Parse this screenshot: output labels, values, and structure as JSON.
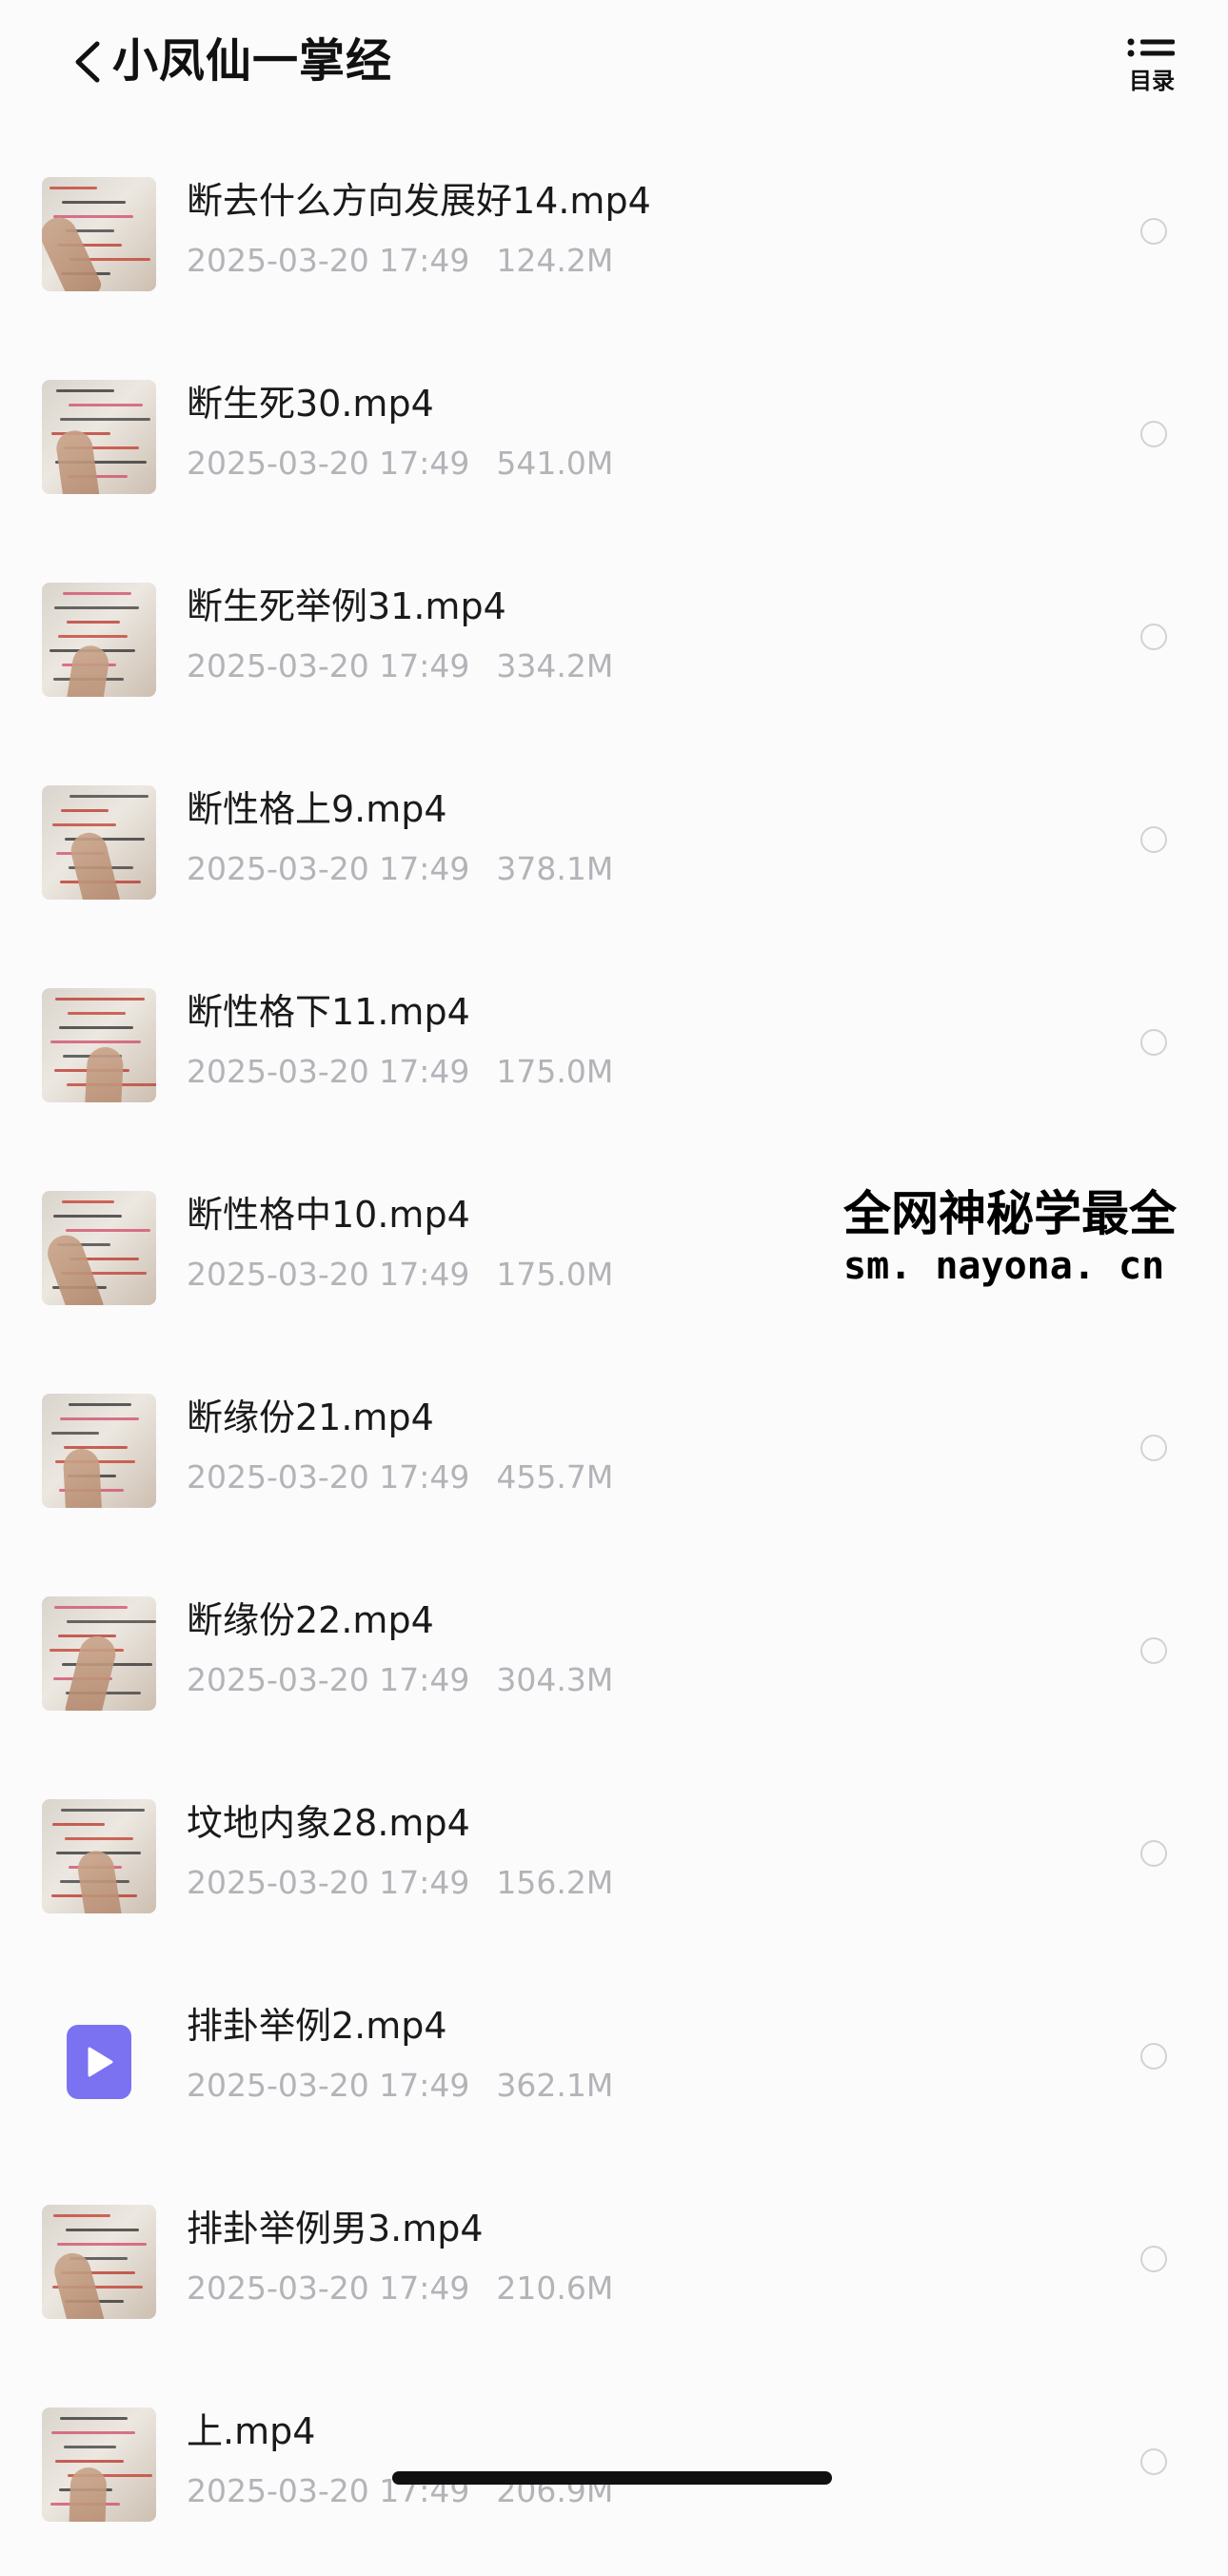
{
  "header": {
    "back_icon": "chevron-left-icon",
    "title": "小凤仙一掌经",
    "toc_icon": "list-icon",
    "toc_label": "目录"
  },
  "files": [
    {
      "name": "断去什么方向发展好14.mp4",
      "date": "2025-03-20 17:49",
      "size": "124.2M",
      "thumb": "photo"
    },
    {
      "name": "断生死30.mp4",
      "date": "2025-03-20 17:49",
      "size": "541.0M",
      "thumb": "photo"
    },
    {
      "name": "断生死举例31.mp4",
      "date": "2025-03-20 17:49",
      "size": "334.2M",
      "thumb": "photo"
    },
    {
      "name": "断性格上9.mp4",
      "date": "2025-03-20 17:49",
      "size": "378.1M",
      "thumb": "photo"
    },
    {
      "name": "断性格下11.mp4",
      "date": "2025-03-20 17:49",
      "size": "175.0M",
      "thumb": "photo"
    },
    {
      "name": "断性格中10.mp4",
      "date": "2025-03-20 17:49",
      "size": "175.0M",
      "thumb": "photo"
    },
    {
      "name": "断缘份21.mp4",
      "date": "2025-03-20 17:49",
      "size": "455.7M",
      "thumb": "photo"
    },
    {
      "name": "断缘份22.mp4",
      "date": "2025-03-20 17:49",
      "size": "304.3M",
      "thumb": "photo"
    },
    {
      "name": "坟地内象28.mp4",
      "date": "2025-03-20 17:49",
      "size": "156.2M",
      "thumb": "photo"
    },
    {
      "name": "排卦举例2.mp4",
      "date": "2025-03-20 17:49",
      "size": "362.1M",
      "thumb": "video-icon"
    },
    {
      "name": "排卦举例男3.mp4",
      "date": "2025-03-20 17:49",
      "size": "210.6M",
      "thumb": "photo"
    },
    {
      "name": "上.mp4",
      "date": "2025-03-20 17:49",
      "size": "206.9M",
      "thumb": "photo"
    }
  ],
  "watermark": {
    "title": "全网神秘学最全",
    "url": "sm. nayona. cn"
  },
  "colors": {
    "background": "#fbfbfc",
    "meta_text": "#b3b3b8",
    "video_icon": "#7b72f2"
  }
}
